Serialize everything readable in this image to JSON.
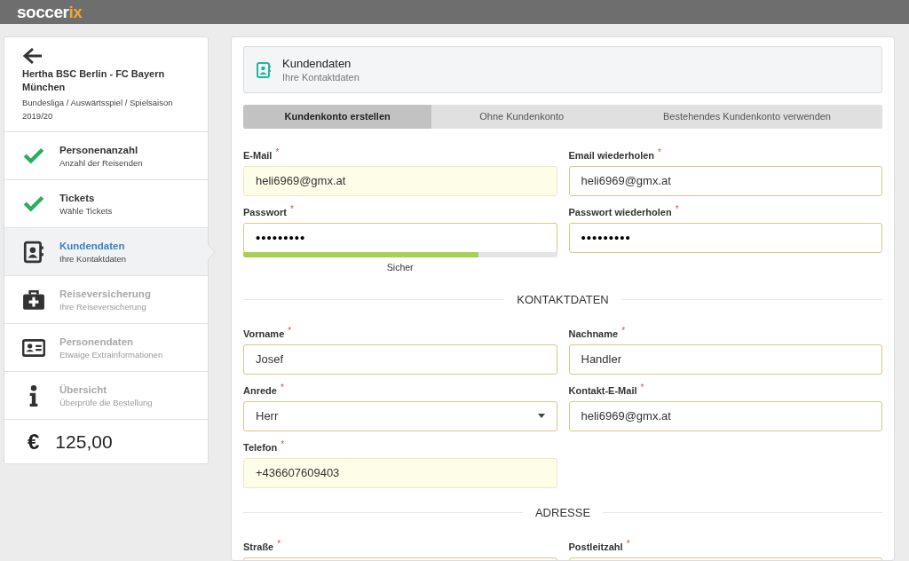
{
  "brand": {
    "main": "soccer",
    "accent": "ix"
  },
  "sidebar": {
    "event_title": "Hertha BSC Berlin - FC Bayern München",
    "event_subtitle": "Bundesliga / Auswärtsspiel / Spielsaison 2019/20",
    "steps": [
      {
        "title": "Personenanzahl",
        "subtitle": "Anzahl der Reisenden",
        "completed": true,
        "disabled": false,
        "selected": false
      },
      {
        "title": "Tickets",
        "subtitle": "Wähle Tickets",
        "completed": true,
        "disabled": false,
        "selected": false
      },
      {
        "kind": "contact",
        "title": "Kundendaten",
        "subtitle": "Ihre Kontaktdaten",
        "completed": false,
        "disabled": false,
        "selected": true
      },
      {
        "kind": "insurance",
        "title": "Reiseversicherung",
        "subtitle": "Ihre Reiseversicherung",
        "completed": false,
        "disabled": true,
        "selected": false
      },
      {
        "kind": "person",
        "title": "Personendaten",
        "subtitle": "Etwaige Extrainformationen",
        "completed": false,
        "disabled": true,
        "selected": false
      },
      {
        "kind": "info",
        "title": "Übersicht",
        "subtitle": "Überprüfe die Bestellung",
        "completed": false,
        "disabled": true,
        "selected": false
      }
    ],
    "currency": "€",
    "total": "125,00"
  },
  "header": {
    "title": "Kundendaten",
    "subtitle": "Ihre Kontaktdaten"
  },
  "tabs": [
    {
      "label": "Kundenkonto erstellen",
      "selected": true
    },
    {
      "label": "Ohne Kundenkonto",
      "selected": false
    },
    {
      "label": "Bestehendes Kundenkonto verwenden",
      "selected": false
    }
  ],
  "form": [
    {
      "kind": "fields",
      "fields": [
        {
          "label": "E-Mail",
          "required_mark": "*",
          "value": "heli6969@gmx.at",
          "kind": "text",
          "autofilled": true
        },
        {
          "label": "Email wiederholen",
          "required_mark": "*",
          "value": "heli6969@gmx.at",
          "kind": "text",
          "autofilled": false
        }
      ]
    },
    {
      "kind": "fields",
      "fields": [
        {
          "label": "Passwort",
          "required_mark": "*",
          "value": "•••••••••",
          "kind": "password",
          "autofilled": false,
          "strength": {
            "level": 0.75,
            "label": "Sicher"
          }
        },
        {
          "label": "Passwort wiederholen",
          "required_mark": "*",
          "value": "•••••••••",
          "kind": "password",
          "autofilled": false
        }
      ]
    },
    {
      "kind": "section",
      "title": "KONTAKTDATEN"
    },
    {
      "kind": "fields",
      "fields": [
        {
          "label": "Vorname",
          "required_mark": "*",
          "value": "Josef",
          "kind": "text",
          "autofilled": false
        },
        {
          "label": "Nachname",
          "required_mark": "*",
          "value": "Handler",
          "kind": "text",
          "autofilled": false
        }
      ]
    },
    {
      "kind": "fields",
      "fields": [
        {
          "label": "Anrede",
          "required_mark": "*",
          "value": "Herr",
          "kind": "select",
          "autofilled": false
        },
        {
          "label": "Kontakt-E-Mail",
          "required_mark": "*",
          "value": "heli6969@gmx.at",
          "kind": "text",
          "autofilled": false
        }
      ]
    },
    {
      "kind": "fields",
      "fields": [
        {
          "label": "Telefon",
          "required_mark": "*",
          "value": "+436607609403",
          "kind": "text",
          "autofilled": true
        }
      ]
    },
    {
      "kind": "section",
      "title": "ADRESSE"
    },
    {
      "kind": "fields",
      "fields": [
        {
          "label": "Straße",
          "required_mark": "*",
          "kind": "text",
          "autofilled": false
        },
        {
          "label": "Postleitzahl",
          "required_mark": "*",
          "kind": "text",
          "autofilled": false
        }
      ]
    }
  ]
}
